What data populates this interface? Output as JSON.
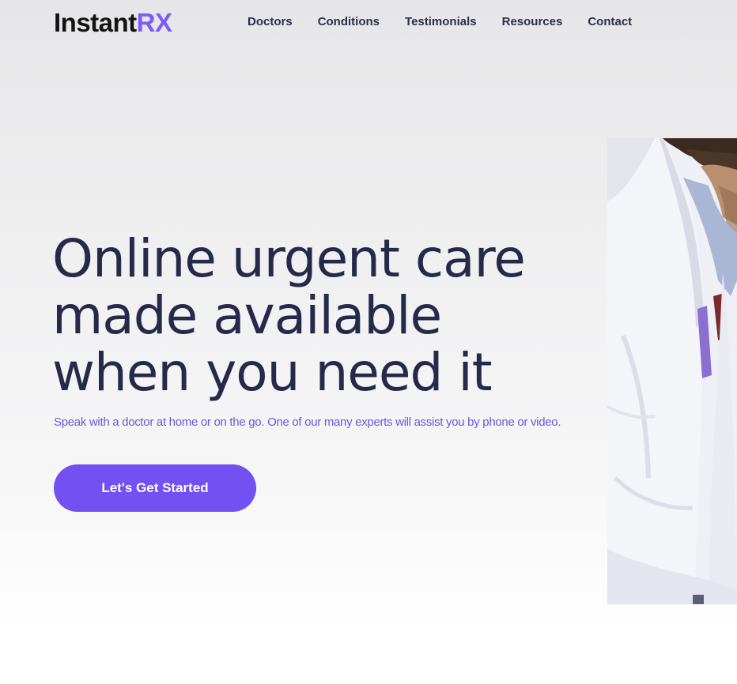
{
  "brand": {
    "part1": "Instant",
    "part2": "RX"
  },
  "nav": {
    "items": [
      {
        "label": "Doctors"
      },
      {
        "label": "Conditions"
      },
      {
        "label": "Testimonials"
      },
      {
        "label": "Resources"
      },
      {
        "label": "Contact"
      }
    ]
  },
  "hero": {
    "headline": [
      "Online urgent care",
      "made available",
      "when you need it"
    ],
    "subtitle": "Speak with a doctor at home or on the go. One of our many experts will assist you by phone or video.",
    "cta_label": "Let's Get Started"
  },
  "colors": {
    "accent": "#7250f2",
    "brand_accent": "#7b5cf5",
    "heading": "#262a4a",
    "subtitle": "#6e55e0"
  },
  "icons": {
    "hero_photo": "doctor-in-white-coat-image"
  }
}
